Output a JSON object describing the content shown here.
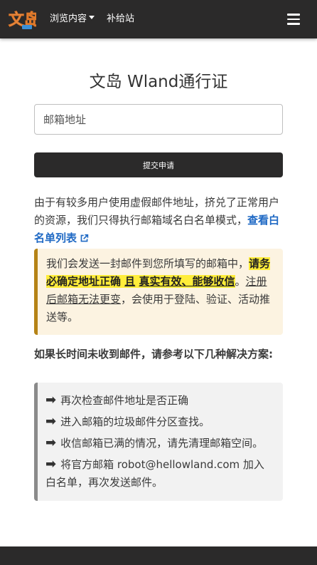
{
  "nav": {
    "logo_text": "文岛",
    "browse_label": "浏览内容",
    "supply_label": "补给站"
  },
  "page": {
    "title": "文岛 Wland通行证"
  },
  "form": {
    "email_placeholder": "邮箱地址",
    "submit_label": "提交申请"
  },
  "notice": {
    "text": "由于有较多用户使用虚假邮件地址，挤兑了正常用户的资源，我们只得执行邮箱域名白名单模式，",
    "link_label": "查看白名单列表"
  },
  "warning": {
    "part1": "我们会发送一封邮件到您所填写的邮箱中，",
    "highlight_a": "请务必确定地址正确",
    "highlight_b": "且",
    "highlight_c": "真实有效、能够收信",
    "period": "。",
    "underline": "注册后邮箱无法更变",
    "part2": "，会使用于登陆、验证、活动推送等。"
  },
  "help": {
    "title": "如果长时间未收到邮件，请参考以下几种解决方案:",
    "items": [
      "再次检查邮件地址是否正确",
      "进入邮箱的垃圾邮件分区查找。",
      "收信邮箱已满的情况，请先清理邮箱空间。",
      "将官方邮箱 robot@hellowland.com 加入白名单，再次发送邮件。"
    ]
  },
  "colors": {
    "navbar": "#2b2a2a",
    "link": "#1f69c4",
    "highlight": "#ffed3a",
    "warning_bg": "#fcf3e1",
    "warning_border": "#b58316"
  }
}
